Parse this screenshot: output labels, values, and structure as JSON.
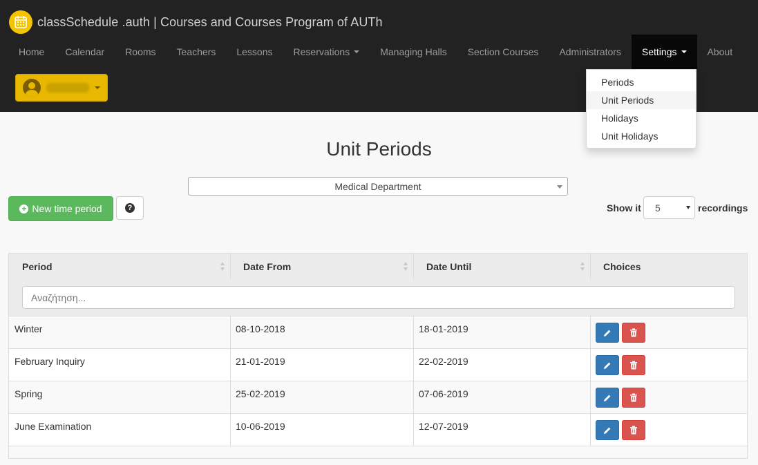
{
  "app": {
    "title": "classSchedule .auth | Courses and Courses Program of AUTh"
  },
  "nav": {
    "items": [
      {
        "label": "Home"
      },
      {
        "label": "Calendar"
      },
      {
        "label": "Rooms"
      },
      {
        "label": "Teachers"
      },
      {
        "label": "Lessons"
      },
      {
        "label": "Reservations",
        "dropdown": true
      },
      {
        "label": "Managing Halls"
      },
      {
        "label": "Section Courses"
      },
      {
        "label": "Administrators"
      },
      {
        "label": "Settings",
        "dropdown": true,
        "active": true
      },
      {
        "label": "About"
      }
    ]
  },
  "user": {
    "name": "jsmalasio"
  },
  "settings_menu": {
    "items": [
      {
        "label": "Periods"
      },
      {
        "label": "Unit Periods",
        "active": true
      },
      {
        "label": "Holidays"
      },
      {
        "label": "Unit Holidays"
      }
    ]
  },
  "page": {
    "title": "Unit Periods",
    "department": "Medical Department",
    "new_button": "New time period",
    "show_label": "Show it",
    "page_size": "5",
    "records_label": "recordings"
  },
  "table": {
    "columns": [
      "Period",
      "Date From",
      "Date Until",
      "Choices"
    ],
    "search_placeholder": "Αναζήτηση...",
    "rows": [
      {
        "period": "Winter",
        "from": "08-10-2018",
        "until": "18-01-2019"
      },
      {
        "period": "February Inquiry",
        "from": "21-01-2019",
        "until": "22-02-2019"
      },
      {
        "period": "Spring",
        "from": "25-02-2019",
        "until": "07-06-2019"
      },
      {
        "period": "June Examination",
        "from": "10-06-2019",
        "until": "12-07-2019"
      }
    ]
  },
  "colors": {
    "navbar": "#222222",
    "brand_accent": "#f5c400",
    "success": "#5cb85c",
    "primary": "#337ab7",
    "danger": "#d9534f"
  }
}
